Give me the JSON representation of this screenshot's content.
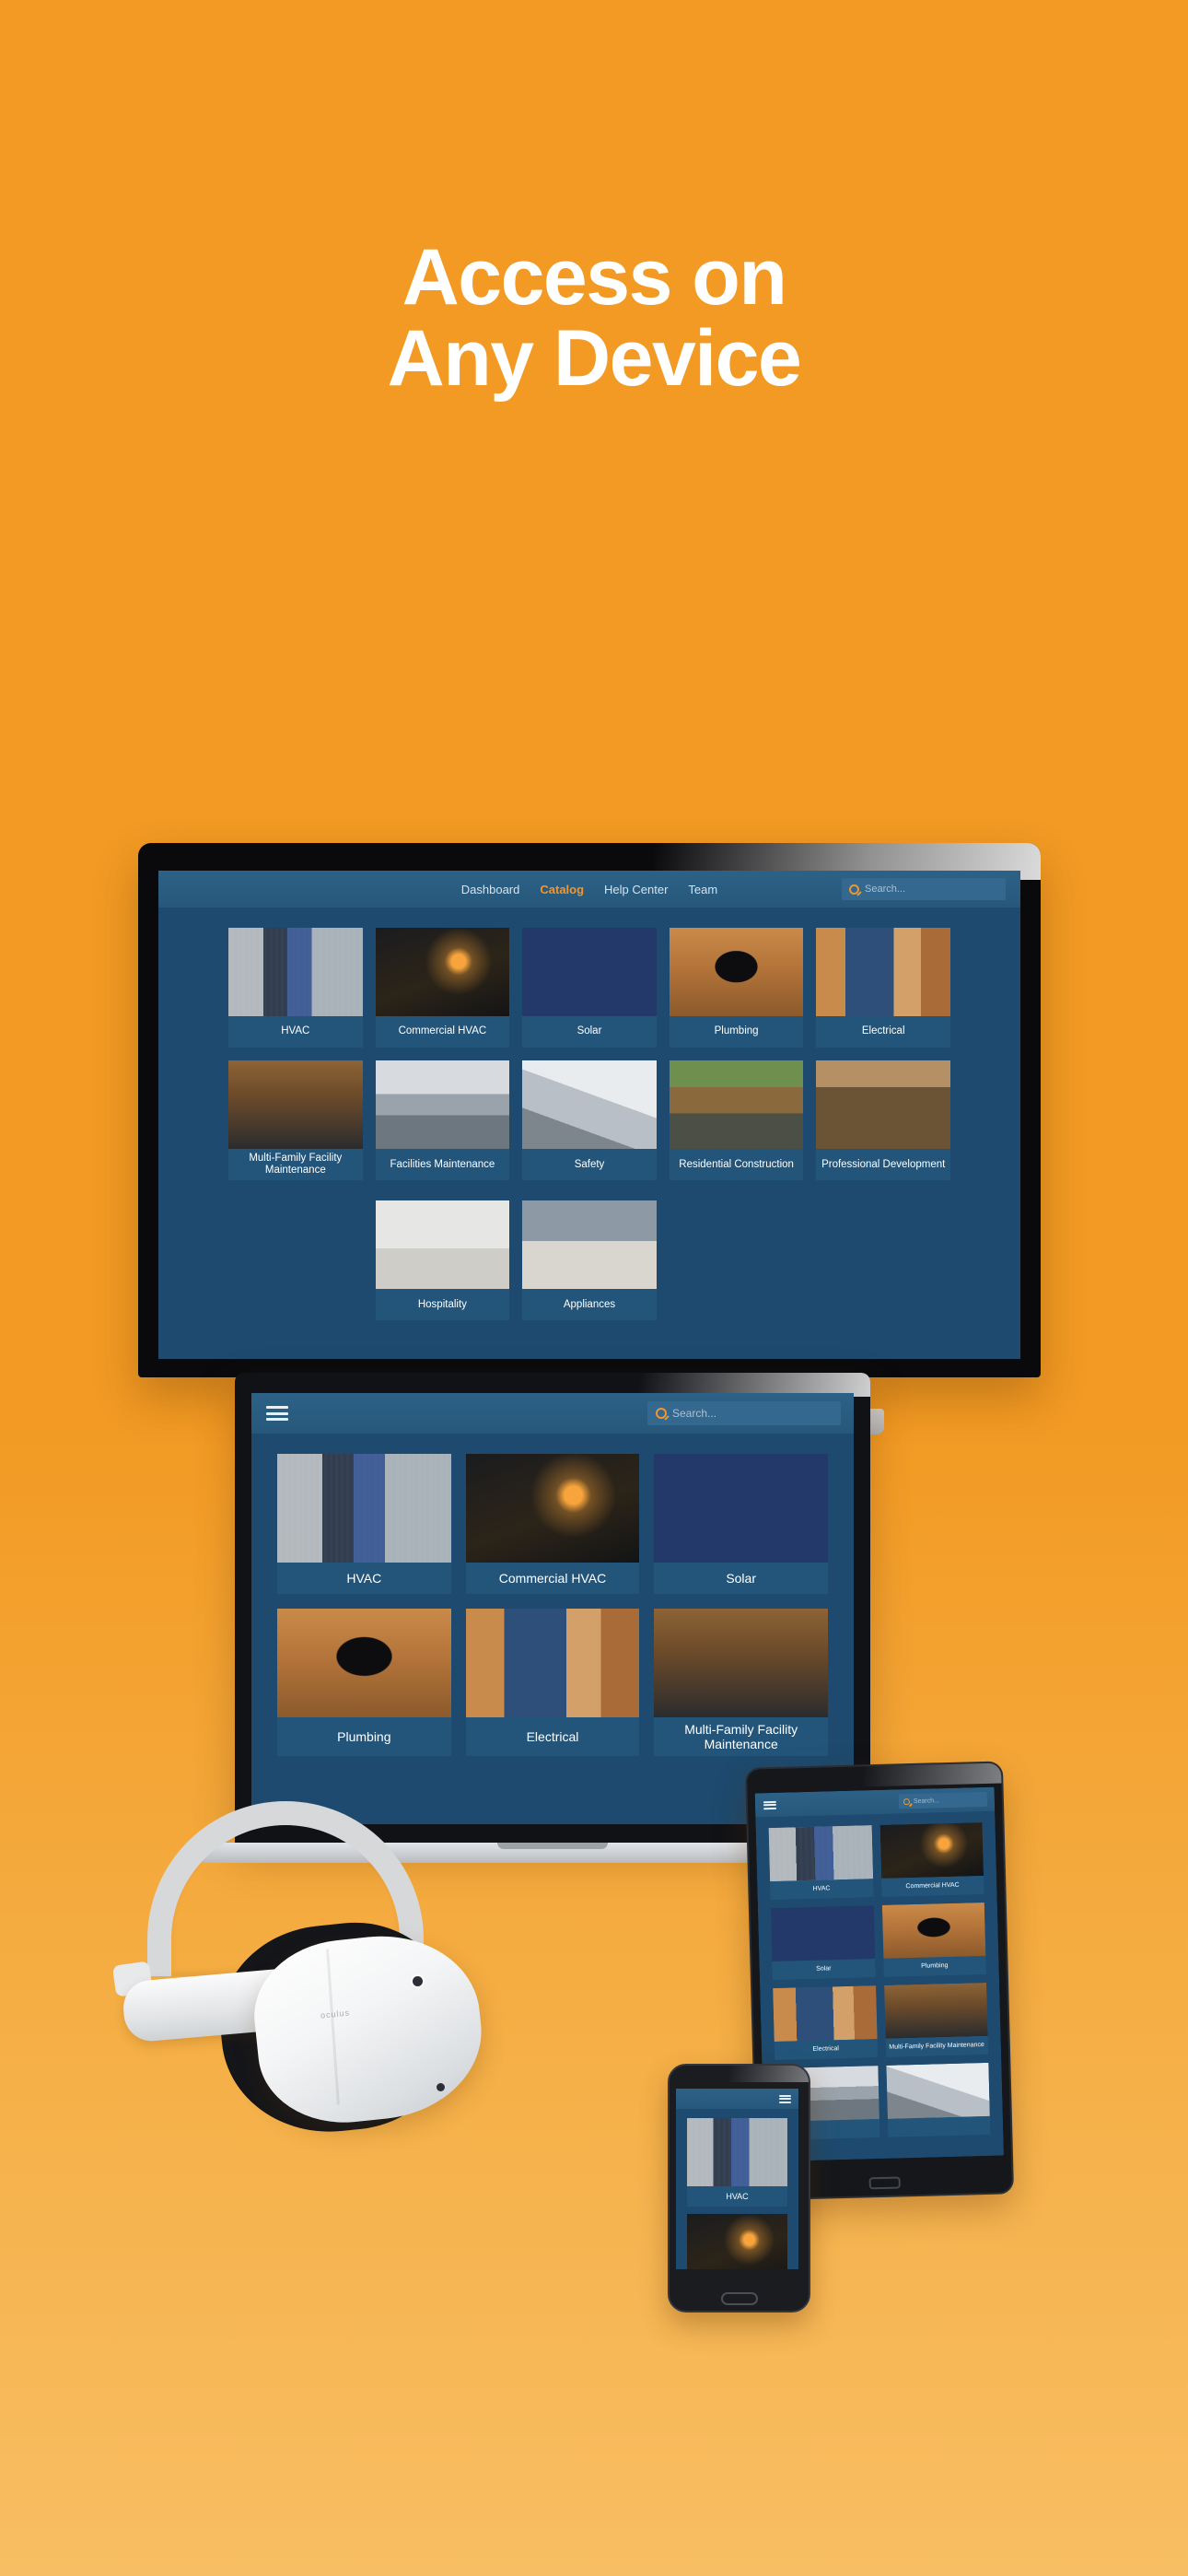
{
  "headline": {
    "line1": "Access on",
    "line2": "Any Device"
  },
  "theme": {
    "background_orange": "#F29A23",
    "background_orange_bottom": "#F8BE63",
    "app_navy": "#1D4A6E",
    "app_tile_navy": "#23557B",
    "accent_orange": "#F0962B",
    "text_white": "#FFFFFF"
  },
  "desktop": {
    "device": "desktop-monitor",
    "nav": {
      "items": [
        {
          "label": "Dashboard",
          "active": false
        },
        {
          "label": "Catalog",
          "active": true
        },
        {
          "label": "Help Center",
          "active": false
        },
        {
          "label": "Team",
          "active": false
        }
      ]
    },
    "search": {
      "placeholder": "Search...",
      "value": "",
      "icon": "search-icon"
    },
    "tiles": [
      {
        "label": "HVAC",
        "photo": "ph-hvac"
      },
      {
        "label": "Commercial HVAC",
        "photo": "ph-commhvac"
      },
      {
        "label": "Solar",
        "photo": "ph-solar"
      },
      {
        "label": "Plumbing",
        "photo": "ph-plumbing"
      },
      {
        "label": "Electrical",
        "photo": "ph-electrical"
      },
      {
        "label": "Multi-Family Facility Maintenance",
        "photo": "ph-multifam"
      },
      {
        "label": "Facilities Maintenance",
        "photo": "ph-facilities"
      },
      {
        "label": "Safety",
        "photo": "ph-safety"
      },
      {
        "label": "Residential Construction",
        "photo": "ph-rescon"
      },
      {
        "label": "Professional Development",
        "photo": "ph-profdev"
      }
    ],
    "tiles_row3": [
      {
        "label": "Hospitality",
        "photo": "ph-hospitality"
      },
      {
        "label": "Appliances",
        "photo": "ph-appliances"
      }
    ]
  },
  "laptop": {
    "device": "laptop",
    "menu_icon": "hamburger-menu-icon",
    "search": {
      "placeholder": "Search...",
      "value": "",
      "icon": "search-icon"
    },
    "tiles": [
      {
        "label": "HVAC",
        "photo": "ph-hvac"
      },
      {
        "label": "Commercial HVAC",
        "photo": "ph-commhvac"
      },
      {
        "label": "Solar",
        "photo": "ph-solar"
      },
      {
        "label": "Plumbing",
        "photo": "ph-plumbing"
      },
      {
        "label": "Electrical",
        "photo": "ph-electrical"
      },
      {
        "label": "Multi-Family Facility Maintenance",
        "photo": "ph-multifam"
      }
    ]
  },
  "tablet": {
    "device": "tablet",
    "menu_icon": "hamburger-menu-icon",
    "search": {
      "placeholder": "Search...",
      "value": "",
      "icon": "search-icon"
    },
    "tiles": [
      {
        "label": "HVAC",
        "photo": "ph-hvac"
      },
      {
        "label": "Commercial HVAC",
        "photo": "ph-commhvac"
      },
      {
        "label": "Solar",
        "photo": "ph-solar"
      },
      {
        "label": "Plumbing",
        "photo": "ph-plumbing"
      },
      {
        "label": "Electrical",
        "photo": "ph-electrical"
      },
      {
        "label": "Multi-Family Facility Maintenance",
        "photo": "ph-multifam"
      },
      {
        "label": "",
        "photo": "ph-facilities"
      },
      {
        "label": "",
        "photo": "ph-safety"
      }
    ]
  },
  "phone": {
    "device": "phone",
    "menu_icon": "hamburger-menu-icon",
    "tiles": [
      {
        "label": "HVAC",
        "photo": "ph-hvac"
      },
      {
        "label": "",
        "photo": "ph-commhvac"
      }
    ]
  },
  "vr": {
    "device": "vr-headset",
    "brand": "oculus"
  }
}
